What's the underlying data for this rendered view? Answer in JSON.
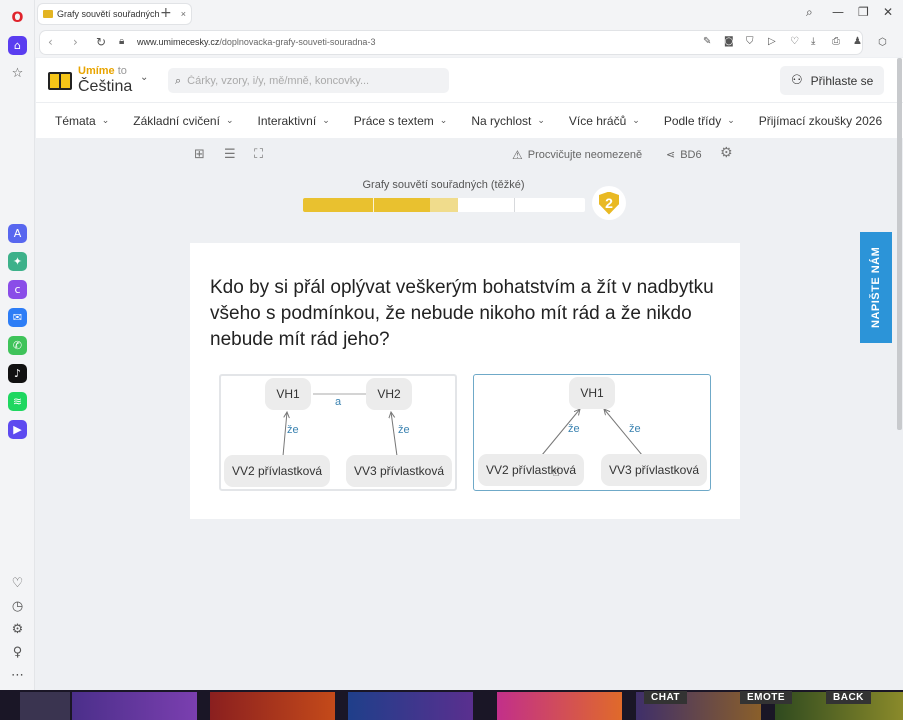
{
  "browser": {
    "tab_title": "Grafy souvětí souřadných",
    "tab_close": "×",
    "new_tab": "+",
    "url_domain": "www.umimecesky.cz",
    "url_path": "/doplnovacka-grafy-souveti-souradna-3"
  },
  "site": {
    "logo_brand": "Umíme",
    "logo_to": "to",
    "logo_subject": "Čeština",
    "search_placeholder": "Čárky, vzory, i/y, mě/mně, koncovky...",
    "login_label": "Přihlaste se"
  },
  "nav": {
    "items": [
      {
        "label": "Témata"
      },
      {
        "label": "Základní cvičení"
      },
      {
        "label": "Interaktivní"
      },
      {
        "label": "Práce s textem"
      },
      {
        "label": "Na rychlost"
      },
      {
        "label": "Více hráčů"
      },
      {
        "label": "Podle třídy"
      },
      {
        "label": "Přijímací zkoušky 2026"
      }
    ]
  },
  "toolbar": {
    "practice_label": "Procvičujte neomezeně",
    "share_code": "BD6"
  },
  "exercise": {
    "title": "Grafy souvětí souřadných (těžké)",
    "level": "2",
    "progress": 0.55,
    "question": "Kdo by si přál oplývat veškerým bohatstvím a žít v nadbytku všeho s podmínkou, že nebude nikoho mít rád a že nikdo nebude mít rád jeho?"
  },
  "options": [
    {
      "nodes": {
        "vh1": "VH1",
        "vh2": "VH2",
        "vv2": "VV2 přívlastková",
        "vv3": "VV3 přívlastková"
      },
      "connectors": {
        "top": "a",
        "left": "že",
        "right": "že"
      }
    },
    {
      "nodes": {
        "vh1": "VH1",
        "vv2": "VV2 přívlastková",
        "vv3": "VV3 přívlastková"
      },
      "connectors": {
        "left": "že",
        "right": "že"
      }
    }
  ],
  "feedback_tab": "NAPIŠTE NÁM",
  "taskbar": {
    "chat": "CHAT",
    "emote": "EMOTE",
    "back": "BACK"
  }
}
